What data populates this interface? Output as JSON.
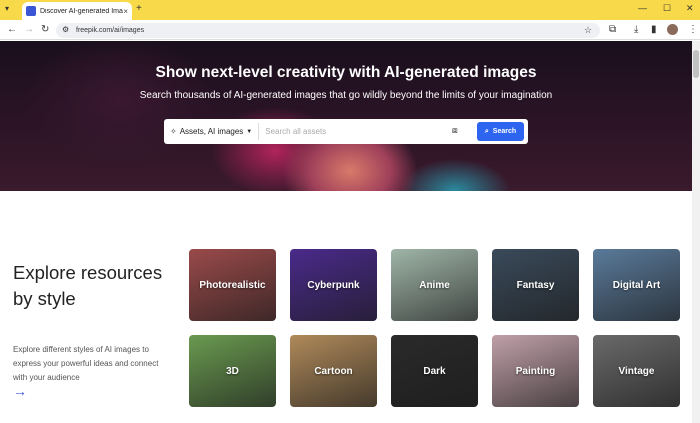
{
  "browser": {
    "tab_title": "Discover AI-generated Images",
    "url": "freepik.com/ai/images",
    "tab_close": "×",
    "new_tab": "+"
  },
  "hero": {
    "title": "Show next-level creativity with AI-generated images",
    "subtitle": "Search thousands of AI-generated images that go wildly beyond the limits of your imagination"
  },
  "search": {
    "selector_label": "Assets, AI images",
    "placeholder": "Search all assets",
    "button_label": "Search"
  },
  "section": {
    "title": "Explore resources by style",
    "description": "Explore different styles of AI images to express your powerful ideas and connect with your audience",
    "arrow": "→"
  },
  "styles": [
    {
      "label": "Photorealistic",
      "color": "#9a4a4a"
    },
    {
      "label": "Cyberpunk",
      "color": "#4a2a8a"
    },
    {
      "label": "Anime",
      "color": "#a0b5a8"
    },
    {
      "label": "Fantasy",
      "color": "#3a4a5a"
    },
    {
      "label": "Digital Art",
      "color": "#5a7a9a"
    },
    {
      "label": "3D",
      "color": "#6a9a50"
    },
    {
      "label": "Cartoon",
      "color": "#b08a5a"
    },
    {
      "label": "Dark",
      "color": "#2a2a2a"
    },
    {
      "label": "Painting",
      "color": "#c0a0a8"
    },
    {
      "label": "Vintage",
      "color": "#6a6a6a"
    }
  ]
}
